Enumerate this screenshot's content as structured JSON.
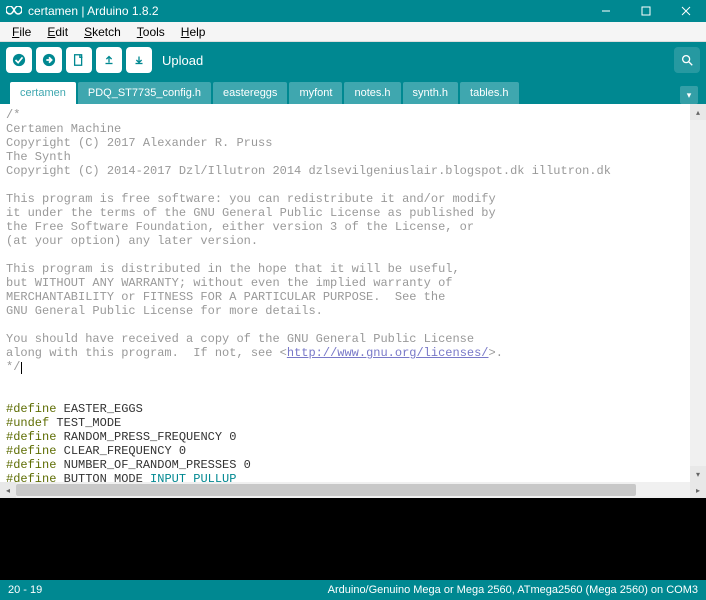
{
  "window": {
    "title": "certamen | Arduino 1.8.2"
  },
  "menu": {
    "file": "File",
    "edit": "Edit",
    "sketch": "Sketch",
    "tools": "Tools",
    "help": "Help"
  },
  "toolbar": {
    "upload_label": "Upload"
  },
  "tabs": [
    {
      "label": "certamen",
      "active": true
    },
    {
      "label": "PDQ_ST7735_config.h",
      "active": false
    },
    {
      "label": "eastereggs",
      "active": false
    },
    {
      "label": "myfont",
      "active": false
    },
    {
      "label": "notes.h",
      "active": false
    },
    {
      "label": "synth.h",
      "active": false
    },
    {
      "label": "tables.h",
      "active": false
    }
  ],
  "code": {
    "c1": "/*",
    "c2": "Certamen Machine",
    "c3": "Copyright (C) 2017 Alexander R. Pruss",
    "c4": "The Synth",
    "c5": "Copyright (C) 2014-2017 Dzl/Illutron 2014 dzlsevilgeniuslair.blogspot.dk illutron.dk",
    "c6": "",
    "c7": "This program is free software: you can redistribute it and/or modify",
    "c8": "it under the terms of the GNU General Public License as published by",
    "c9": "the Free Software Foundation, either version 3 of the License, or",
    "c10": "(at your option) any later version.",
    "c11": "",
    "c12": "This program is distributed in the hope that it will be useful,",
    "c13": "but WITHOUT ANY WARRANTY; without even the implied warranty of",
    "c14": "MERCHANTABILITY or FITNESS FOR A PARTICULAR PURPOSE.  See the",
    "c15": "GNU General Public License for more details.",
    "c16": "",
    "c17": "You should have received a copy of the GNU General Public License",
    "c18a": "along with this program.  If not, see <",
    "c18link": "http://www.gnu.org/licenses/",
    "c18b": ">.",
    "c19": "*/",
    "blank": "",
    "d1a": "#define",
    "d1b": " EASTER_EGGS",
    "d2a": "#undef",
    "d2b": " TEST_MODE",
    "d3a": "#define",
    "d3b": " RANDOM_PRESS_FREQUENCY 0",
    "d4a": "#define",
    "d4b": " CLEAR_FREQUENCY 0",
    "d5a": "#define",
    "d5b": " NUMBER_OF_RANDOM_PRESSES 0",
    "d6a": "#define",
    "d6b": " BUTTON_MODE ",
    "d6c": "INPUT_PULLUP"
  },
  "status": {
    "left": "20 - 19",
    "right": "Arduino/Genuino Mega or Mega 2560, ATmega2560 (Mega 2560) on COM3"
  }
}
